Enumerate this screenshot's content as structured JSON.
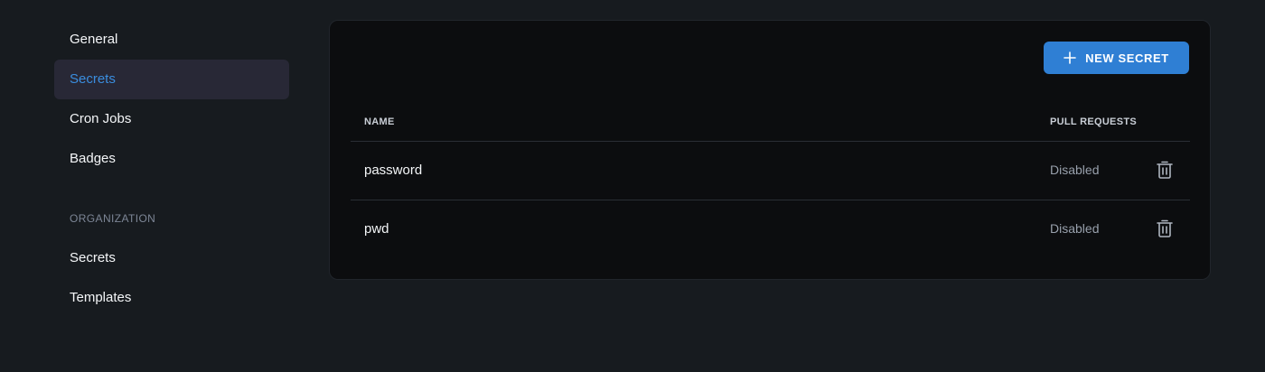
{
  "sidebar": {
    "items": [
      {
        "label": "General"
      },
      {
        "label": "Secrets"
      },
      {
        "label": "Cron Jobs"
      },
      {
        "label": "Badges"
      }
    ],
    "section_label": "ORGANIZATION",
    "org_items": [
      {
        "label": "Secrets"
      },
      {
        "label": "Templates"
      }
    ],
    "active_item": "Secrets"
  },
  "toolbar": {
    "new_secret_label": "NEW SECRET",
    "new_secret_icon": "plus-icon"
  },
  "table": {
    "columns": {
      "name": "NAME",
      "pull_requests": "PULL REQUESTS"
    },
    "rows": [
      {
        "name": "password",
        "pull_requests": "Disabled",
        "action_icon": "trash-icon"
      },
      {
        "name": "pwd",
        "pull_requests": "Disabled",
        "action_icon": "trash-icon"
      }
    ]
  },
  "colors": {
    "background": "#171b1f",
    "card": "#0c0d0f",
    "accent": "#2f7fd4",
    "active_text": "#3a8dde",
    "active_bg": "#282836"
  }
}
